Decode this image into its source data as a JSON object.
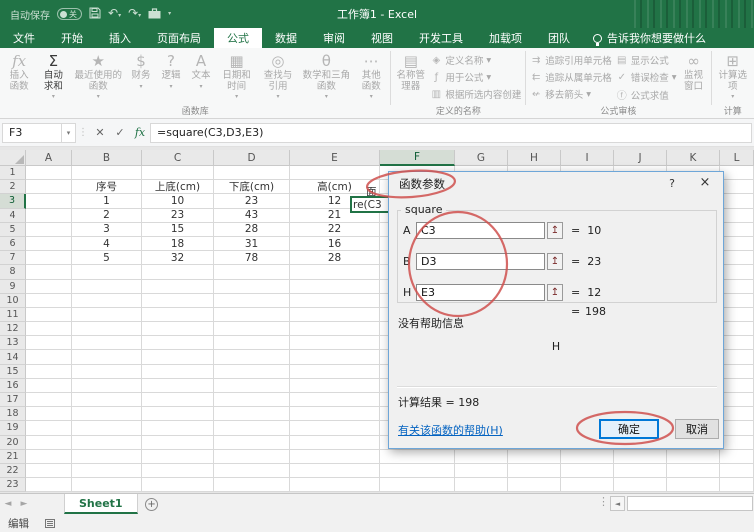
{
  "window": {
    "title": "工作簿1 - Excel"
  },
  "quick_access": {
    "autosave_label": "自动保存",
    "autosave_state": "关",
    "icons": [
      "save-icon",
      "undo-icon",
      "redo-icon",
      "briefcase-icon",
      "qat-customize-icon"
    ]
  },
  "ribbon": {
    "file_tab": "文件",
    "tabs": [
      "开始",
      "插入",
      "页面布局",
      "公式",
      "数据",
      "审阅",
      "视图",
      "开发工具",
      "加载项",
      "团队"
    ],
    "active_tab": "公式",
    "tell_me": "告诉我你想要做什么",
    "groups": [
      {
        "name": "函数库",
        "items": [
          {
            "type": "big",
            "label": "插入函数",
            "icon": "insert-function-icon",
            "enabled": false,
            "dropdown": false
          },
          {
            "type": "big",
            "label": "自动求和",
            "icon": "autosum-icon",
            "enabled": true,
            "dropdown": true
          },
          {
            "type": "big",
            "label": "最近使用的函数",
            "icon": "recent-functions-icon",
            "enabled": false,
            "dropdown": true
          },
          {
            "type": "big",
            "label": "财务",
            "icon": "financial-icon",
            "enabled": false,
            "dropdown": true
          },
          {
            "type": "big",
            "label": "逻辑",
            "icon": "logical-icon",
            "enabled": false,
            "dropdown": true
          },
          {
            "type": "big",
            "label": "文本",
            "icon": "text-icon",
            "enabled": false,
            "dropdown": true
          },
          {
            "type": "big",
            "label": "日期和时间",
            "icon": "datetime-icon",
            "enabled": false,
            "dropdown": true
          },
          {
            "type": "big",
            "label": "查找与引用",
            "icon": "lookup-icon",
            "enabled": false,
            "dropdown": true
          },
          {
            "type": "big",
            "label": "数学和三角函数",
            "icon": "math-trig-icon",
            "enabled": false,
            "dropdown": true
          },
          {
            "type": "big",
            "label": "其他函数",
            "icon": "more-functions-icon",
            "enabled": false,
            "dropdown": true
          }
        ]
      },
      {
        "name": "定义的名称",
        "items": [
          {
            "type": "big",
            "label": "名称管理器",
            "icon": "name-manager-icon",
            "enabled": false,
            "dropdown": false
          },
          {
            "type": "stack",
            "buttons": [
              {
                "label": "定义名称",
                "icon": "define-name-icon",
                "dropdown": true
              },
              {
                "label": "用于公式",
                "icon": "use-in-formula-icon",
                "dropdown": true
              },
              {
                "label": "根据所选内容创建",
                "icon": "create-from-selection-icon",
                "dropdown": false
              }
            ]
          }
        ]
      },
      {
        "name": "公式审核",
        "items": [
          {
            "type": "stack",
            "buttons": [
              {
                "label": "追踪引用单元格",
                "icon": "trace-precedents-icon",
                "dropdown": false
              },
              {
                "label": "追踪从属单元格",
                "icon": "trace-dependents-icon",
                "dropdown": false
              },
              {
                "label": "移去箭头",
                "icon": "remove-arrows-icon",
                "dropdown": true
              }
            ]
          },
          {
            "type": "stack",
            "buttons": [
              {
                "label": "显示公式",
                "icon": "show-formulas-icon",
                "dropdown": false
              },
              {
                "label": "错误检查",
                "icon": "error-checking-icon",
                "dropdown": true
              },
              {
                "label": "公式求值",
                "icon": "evaluate-formula-icon",
                "dropdown": false
              }
            ]
          },
          {
            "type": "big",
            "label": "监视窗口",
            "icon": "watch-window-icon",
            "enabled": false,
            "dropdown": false
          }
        ]
      },
      {
        "name": "计算",
        "items": [
          {
            "type": "big",
            "label": "计算选项",
            "icon": "calculation-options-icon",
            "enabled": false,
            "dropdown": true
          }
        ]
      }
    ]
  },
  "formula_bar": {
    "name_box": "F3",
    "formula": "=square(C3,D3,E3)"
  },
  "grid": {
    "columns": [
      "A",
      "B",
      "C",
      "D",
      "E",
      "F",
      "G",
      "H",
      "I",
      "J",
      "K",
      "L"
    ],
    "row_count": 23,
    "selected_cell": "F3",
    "selected_column": "F",
    "selected_row": 3,
    "rows": {
      "2": {
        "B": "序号",
        "C": "上底(cm)",
        "D": "下底(cm)",
        "E": "高(cm)"
      },
      "3": {
        "B": "1",
        "C": "10",
        "D": "23",
        "E": "12"
      },
      "4": {
        "B": "2",
        "C": "23",
        "D": "43",
        "E": "21"
      },
      "5": {
        "B": "3",
        "C": "15",
        "D": "28",
        "E": "22"
      },
      "6": {
        "B": "4",
        "C": "18",
        "D": "31",
        "E": "16"
      },
      "7": {
        "B": "5",
        "C": "32",
        "D": "78",
        "E": "28"
      }
    },
    "f2_overflow": "面",
    "f3_edit_fragment": "re(C3"
  },
  "dialog": {
    "title": "函数参数",
    "help_button": "?",
    "close_button": "×",
    "function_name": "square",
    "eq": "=",
    "args": [
      {
        "name": "A",
        "value": "C3",
        "result": "10"
      },
      {
        "name": "B",
        "value": "D3",
        "result": "23"
      },
      {
        "name": "H",
        "value": "E3",
        "result": "12"
      }
    ],
    "formula_result": "198",
    "no_help_text": "没有帮助信息",
    "selected_arg_hint": "H",
    "result_line": "计算结果 =  198",
    "help_link": "有关该函数的帮助(H)",
    "ok_label": "确定",
    "cancel_label": "取消"
  },
  "sheet_bar": {
    "tabs": [
      {
        "label": "Sheet1",
        "active": true
      }
    ]
  },
  "status_bar": {
    "mode": "编辑"
  },
  "colors": {
    "excel_green": "#217346",
    "annotation_red": "#cf504d",
    "link_blue": "#0563c1",
    "ok_focus_blue": "#0078d7",
    "dialog_border": "#6ea6d8"
  }
}
